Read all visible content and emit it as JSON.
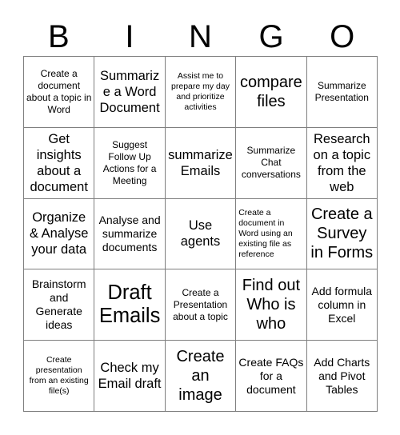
{
  "header": {
    "letters": [
      "B",
      "I",
      "N",
      "G",
      "O"
    ]
  },
  "grid": {
    "rows": 5,
    "columns": 5,
    "border_color": "#7f7f7f",
    "background_color": "#ffffff",
    "text_color": "#000000",
    "cells": [
      {
        "text": "Create a document about a topic in Word",
        "size": "fs-sm",
        "align": "center"
      },
      {
        "text": "Summarize a Word Document",
        "size": "fs-lg",
        "align": "center"
      },
      {
        "text": "Assist me to prepare my day and prioritize activities",
        "size": "fs-xs",
        "align": "center"
      },
      {
        "text": "compare files",
        "size": "fs-xl",
        "align": "center"
      },
      {
        "text": "Summarize Presentation",
        "size": "fs-sm",
        "align": "center"
      },
      {
        "text": "Get insights about a document",
        "size": "fs-lg",
        "align": "center"
      },
      {
        "text": "Suggest Follow Up Actions for a Meeting",
        "size": "fs-sm",
        "align": "center"
      },
      {
        "text": "summarize Emails",
        "size": "fs-lg",
        "align": "center"
      },
      {
        "text": "Summarize Chat conversations",
        "size": "fs-sm",
        "align": "center"
      },
      {
        "text": "Research on a topic from the web",
        "size": "fs-lg",
        "align": "center"
      },
      {
        "text": "Organize & Analyse your data",
        "size": "fs-lg",
        "align": "center"
      },
      {
        "text": "Analyse and summarize documents",
        "size": "fs-md",
        "align": "center"
      },
      {
        "text": "Use agents",
        "size": "fs-lg",
        "align": "center"
      },
      {
        "text": "Create a document in Word using an existing file as reference",
        "size": "fs-xs",
        "align": "left"
      },
      {
        "text": "Create a Survey in Forms",
        "size": "fs-xl",
        "align": "center"
      },
      {
        "text": "Brainstorm and Generate ideas",
        "size": "fs-md",
        "align": "center"
      },
      {
        "text": "Draft Emails",
        "size": "fs-xxl",
        "align": "center"
      },
      {
        "text": "Create a Presentation about a topic",
        "size": "fs-sm",
        "align": "center"
      },
      {
        "text": "Find out Who is who",
        "size": "fs-xl",
        "align": "center"
      },
      {
        "text": "Add formula column in Excel",
        "size": "fs-md",
        "align": "center"
      },
      {
        "text": "Create presentation from an existing file(s)",
        "size": "fs-xs",
        "align": "center"
      },
      {
        "text": "Check my Email draft",
        "size": "fs-lg",
        "align": "center"
      },
      {
        "text": "Create an image",
        "size": "fs-xl",
        "align": "center"
      },
      {
        "text": "Create FAQs for a document",
        "size": "fs-md",
        "align": "center"
      },
      {
        "text": "Add Charts and Pivot Tables",
        "size": "fs-md",
        "align": "center"
      }
    ]
  }
}
